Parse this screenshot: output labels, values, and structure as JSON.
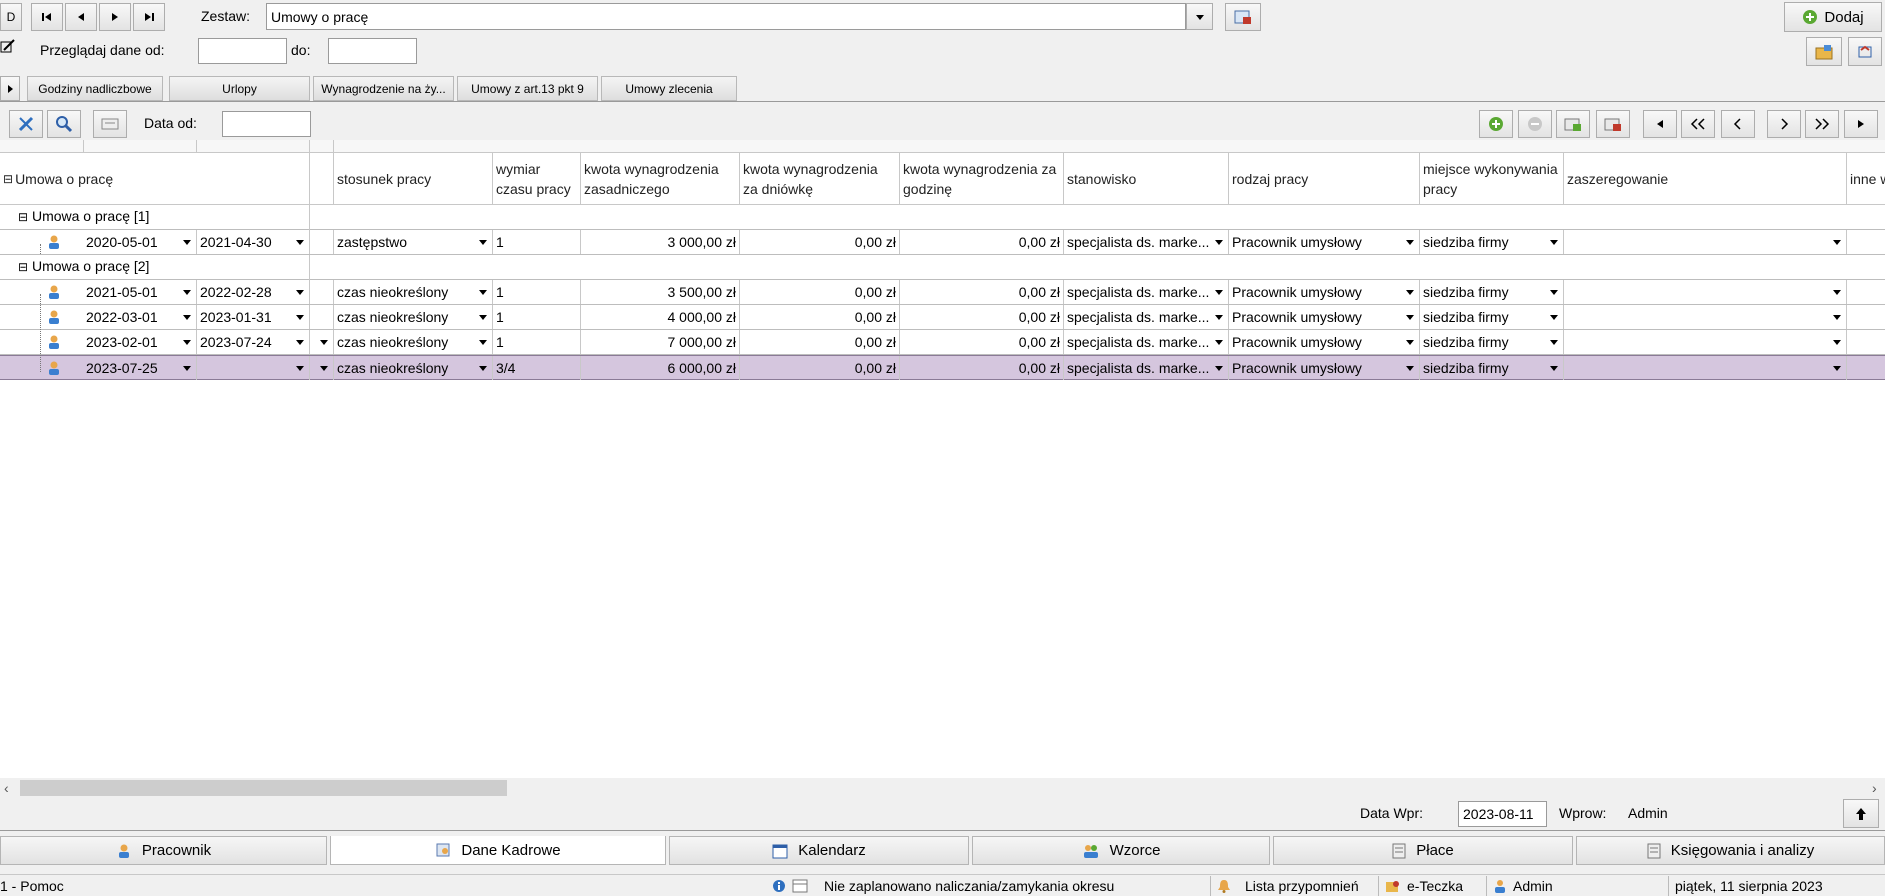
{
  "top": {
    "nav_d": "D",
    "zestaw_label": "Zestaw:",
    "zestaw_value": "Umowy o pracę",
    "add_label": "Dodaj",
    "przegladaj_label": "Przeglądaj dane od:",
    "do_label": "do:",
    "przegladaj_od": "",
    "przegladaj_do": ""
  },
  "tabs": [
    "Godziny nadliczbowe",
    "Urlopy",
    "Wynagrodzenie na ży...",
    "Umowy z art.13 pkt 9",
    "Umowy zlecenia"
  ],
  "toolbar": {
    "data_od_label": "Data od:",
    "data_od_value": ""
  },
  "grid": {
    "root_group": "Umowa o pracę",
    "columns": [
      "stosunek pracy",
      "wymiar czasu pracy",
      "kwota wynagrodzenia zasadniczego",
      "kwota wynagrodzenia za dniówkę",
      "kwota wynagrodzenia za godzinę",
      "stanowisko",
      "rodzaj pracy",
      "miejsce wykonywania pracy",
      "zaszeregowanie",
      "inne w"
    ],
    "group1": "Umowa o pracę [1]",
    "group2": "Umowa o pracę [2]",
    "rows": [
      {
        "from": "2020-05-01",
        "to": "2021-04-30",
        "stosunek": "zastępstwo",
        "wymiar": "1",
        "zasadnicze": "3 000,00 zł",
        "dniowka": "0,00 zł",
        "godzina": "0,00 zł",
        "stanowisko": "specjalista ds. marke...",
        "rodzaj": "Pracownik umysłowy",
        "miejsce": "siedziba firmy",
        "zaszeregowanie": ""
      },
      {
        "from": "2021-05-01",
        "to": "2022-02-28",
        "stosunek": "czas nieokreślony",
        "wymiar": "1",
        "zasadnicze": "3 500,00 zł",
        "dniowka": "0,00 zł",
        "godzina": "0,00 zł",
        "stanowisko": "specjalista ds. marke...",
        "rodzaj": "Pracownik umysłowy",
        "miejsce": "siedziba firmy",
        "zaszeregowanie": ""
      },
      {
        "from": "2022-03-01",
        "to": "2023-01-31",
        "stosunek": "czas nieokreślony",
        "wymiar": "1",
        "zasadnicze": "4 000,00 zł",
        "dniowka": "0,00 zł",
        "godzina": "0,00 zł",
        "stanowisko": "specjalista ds. marke...",
        "rodzaj": "Pracownik umysłowy",
        "miejsce": "siedziba firmy",
        "zaszeregowanie": ""
      },
      {
        "from": "2023-02-01",
        "to": "2023-07-24",
        "stosunek": "czas nieokreślony",
        "wymiar": "1",
        "zasadnicze": "7 000,00 zł",
        "dniowka": "0,00 zł",
        "godzina": "0,00 zł",
        "stanowisko": "specjalista ds. marke...",
        "rodzaj": "Pracownik umysłowy",
        "miejsce": "siedziba firmy",
        "zaszeregowanie": ""
      },
      {
        "from": "2023-07-25",
        "to": "",
        "stosunek": "czas nieokreślony",
        "wymiar": "3/4",
        "zasadnicze": "6 000,00 zł",
        "dniowka": "0,00 zł",
        "godzina": "0,00 zł",
        "stanowisko": "specjalista ds. marke...",
        "rodzaj": "Pracownik umysłowy",
        "miejsce": "siedziba firmy",
        "zaszeregowanie": ""
      }
    ]
  },
  "bottom_info": {
    "data_wpr_label": "Data Wpr:",
    "data_wpr_value": "2023-08-11",
    "wprow_label": "Wprow:",
    "wprow_value": "Admin"
  },
  "bottom_tabs": [
    "Pracownik",
    "Dane Kadrowe",
    "Kalendarz",
    "Wzorce",
    "Płace",
    "Księgowania i analizy"
  ],
  "status": {
    "help": "1 - Pomoc",
    "period": "Nie zaplanowano naliczania/zamykania okresu",
    "reminders": "Lista przypomnień",
    "eteczka": "e-Teczka",
    "user": "Admin",
    "date": "piątek, 11 sierpnia 2023"
  },
  "colors": {
    "selected_row": "#d5c6de",
    "accent_green": "#4a9a2a"
  }
}
